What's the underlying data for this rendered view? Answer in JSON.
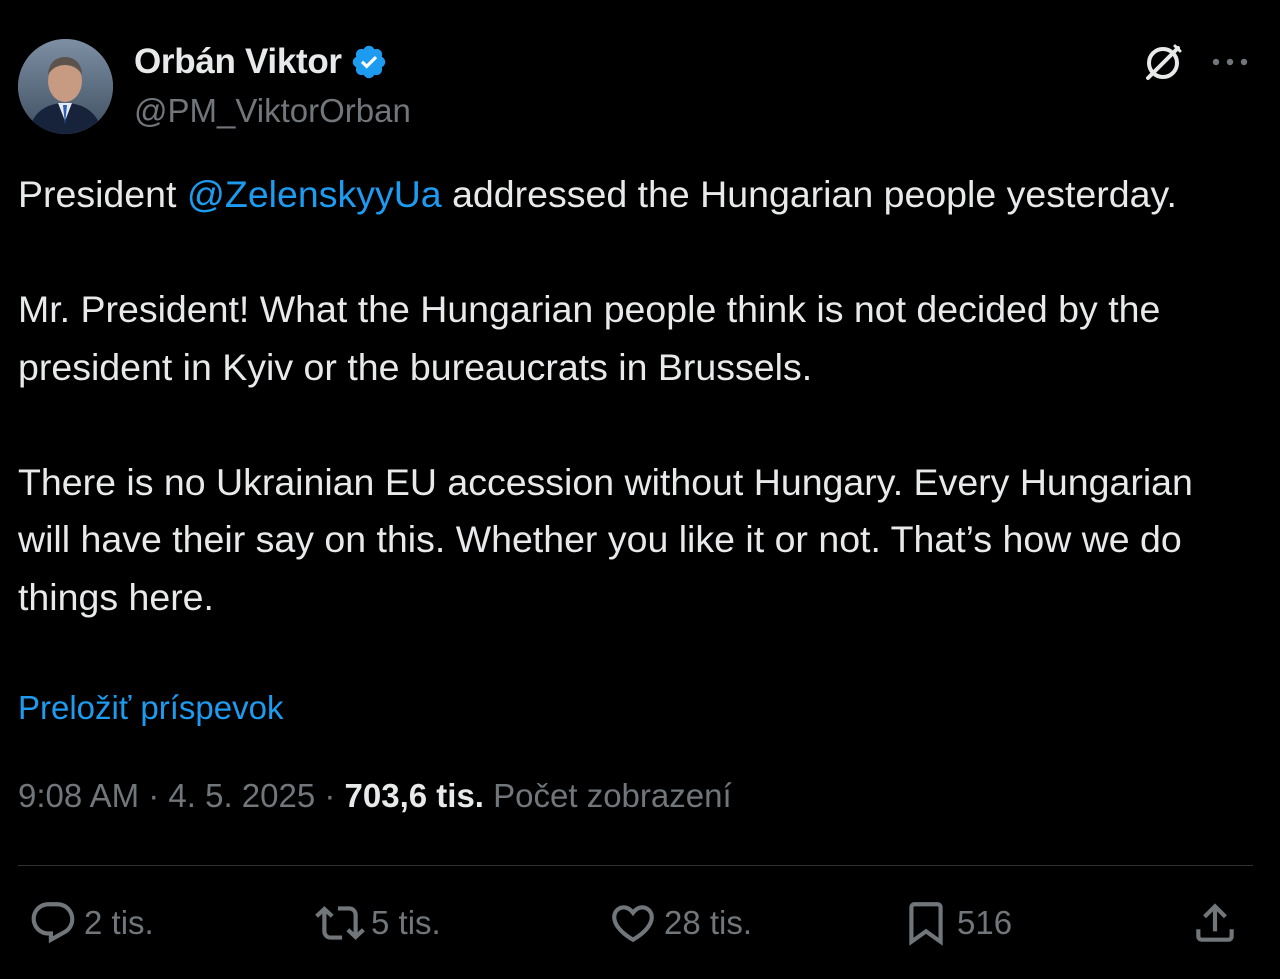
{
  "author": {
    "display_name": "Orbán Viktor",
    "handle": "@PM_ViktorOrban",
    "verified_icon": "verified-badge-icon",
    "verified_color": "#1d9bf0"
  },
  "header_actions": {
    "grok_icon": "grok-icon",
    "more_icon": "more-horizontal-icon"
  },
  "tweet": {
    "text_before_mention": "President ",
    "mention": "@ZelenskyyUa",
    "text_after_mention": " addressed the Hungarian people yesterday.\n\nMr. President! What the Hungarian people think is not decided by the president in Kyiv or the bureaucrats in Brussels.\n\nThere is no Ukrainian EU accession without Hungary. Every Hungarian will have their say on this. Whether you like it or not. That’s how we do things here.",
    "translate_label": "Preložiť príspevok"
  },
  "meta": {
    "time": "9:08 AM",
    "date": "4. 5. 2025",
    "views_count": "703,6 tis.",
    "views_label": "Počet zobrazení",
    "separator": " · "
  },
  "actions": {
    "replies": "2 tis.",
    "reposts": "5 tis.",
    "likes": "28 tis.",
    "bookmarks": "516"
  },
  "colors": {
    "background": "#000000",
    "text": "#e7e9ea",
    "secondary": "#71767b",
    "accent": "#1d9bf0",
    "divider": "#2f3336"
  }
}
